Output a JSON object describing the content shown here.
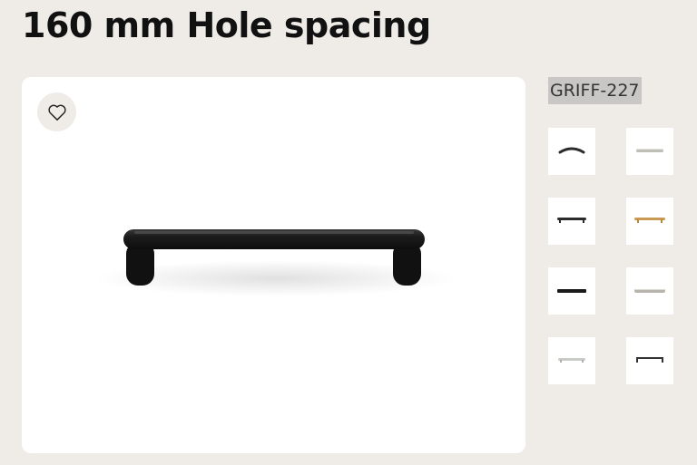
{
  "page": {
    "title": "160 mm Hole spacing"
  },
  "product": {
    "sku": "GRIFF-227",
    "favorite_icon": "heart-outline-icon",
    "main_image": "black-bar-handle"
  },
  "variants": [
    {
      "name": "black-curved-handle",
      "color": "#2b2b2b",
      "selected": false
    },
    {
      "name": "silver-bar-handle",
      "color": "#bfbfb8",
      "selected": false
    },
    {
      "name": "black-bar-handle",
      "color": "#2b2b2b",
      "selected": true
    },
    {
      "name": "brass-bar-handle",
      "color": "#c99a52",
      "selected": false
    },
    {
      "name": "black-flat-handle",
      "color": "#1a1a1a",
      "selected": false
    },
    {
      "name": "stainless-bar-handle",
      "color": "#b9b5ae",
      "selected": false
    },
    {
      "name": "chrome-bar-handle",
      "color": "#c9cbc6",
      "selected": false
    },
    {
      "name": "black-wire-handle",
      "color": "#333333",
      "selected": false
    }
  ]
}
